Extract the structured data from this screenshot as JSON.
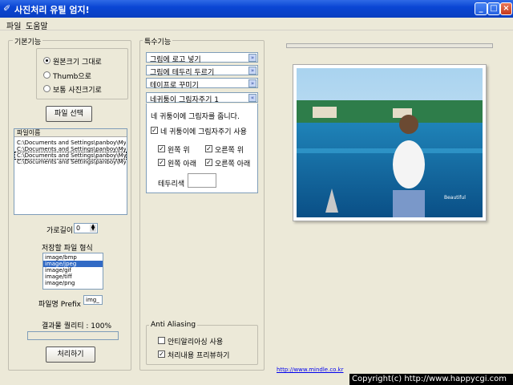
{
  "window": {
    "title": "사진처리 유틸 엄지!"
  },
  "menu": {
    "items": [
      "파일",
      "도움말"
    ]
  },
  "basic": {
    "group_label": "기본기능",
    "radios": [
      {
        "label": "원본크기 그대로",
        "checked": true
      },
      {
        "label": "Thumb으로",
        "checked": false
      },
      {
        "label": "보통 사진크기로",
        "checked": false
      }
    ],
    "select_file_button": "파일 선택",
    "file_list_header": "파일이름",
    "files": [
      "C:\\Documents and Settings\\panboy\\My Do...",
      "C:\\Documents and Settings\\panboy\\My Do...",
      "C:\\Documents and Settings\\panboy\\My Do...",
      "C:\\Documents and Settings\\panboy\\My Do..."
    ],
    "width_label": "가로길이",
    "width_value": "0",
    "format_label": "저장할 파일 형식",
    "formats": [
      "image/bmp",
      "image/jpeg",
      "image/gif",
      "image/tiff",
      "image/png"
    ],
    "selected_format_index": 1,
    "prefix_label": "파일명 Prefix",
    "prefix_value": "img_",
    "quality_label": "결과물 퀄리티 : 100%",
    "quality_percent": 100,
    "process_button": "처리하기"
  },
  "special": {
    "group_label": "특수기능",
    "sections": [
      "그림에 로고 넣기",
      "그림에 테두리 두르기",
      "테이프로 꾸미기",
      "네귀퉁이 그림자주기 1"
    ],
    "shadow_panel": {
      "description": "네 귀퉁이에 그림자를 줍니다.",
      "enable_label": "네 귀퉁이에 그림자주기 사용",
      "enable_checked": true,
      "corners": [
        {
          "label": "왼쪽 위",
          "checked": true
        },
        {
          "label": "오른쪽 위",
          "checked": true
        },
        {
          "label": "왼쪽 아래",
          "checked": true
        },
        {
          "label": "오른쪽 아래",
          "checked": true
        }
      ],
      "border_color_label": "테두리색"
    },
    "anti_aliasing": {
      "group_label": "Anti Aliasing",
      "use_label": "안티알리아싱 사용",
      "use_checked": false,
      "preview_label": "처리내용 프리뷰하기",
      "preview_checked": true
    }
  },
  "preview": {
    "photo_caption": "Beautiful",
    "link": "http://www.mindle.co.kr"
  },
  "status": {
    "copyright": "Copyright(c) http://www.happycgi.com"
  },
  "colors": {
    "titlebar": "#0a46d4",
    "selection": "#316ac5",
    "link": "#0000ee"
  }
}
